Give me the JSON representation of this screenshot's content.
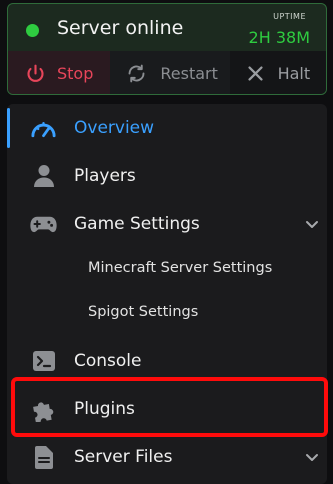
{
  "status": {
    "text": "Server online",
    "uptime_label": "UPTIME",
    "uptime_value": "2H 38M",
    "indicator_color": "#2ecc40"
  },
  "actions": {
    "stop_label": "Stop",
    "restart_label": "Restart",
    "halt_label": "Halt"
  },
  "nav": {
    "overview": "Overview",
    "players": "Players",
    "game_settings": "Game Settings",
    "minecraft_settings": "Minecraft Server Settings",
    "spigot_settings": "Spigot Settings",
    "console": "Console",
    "plugins": "Plugins",
    "server_files": "Server Files"
  },
  "colors": {
    "accent": "#3aa0ff",
    "stop": "#e8455a",
    "highlight": "#ff0b0b"
  },
  "icons": {
    "overview": "speedometer-icon",
    "players": "person-icon",
    "game_settings": "gamepad-icon",
    "console": "terminal-icon",
    "plugins": "puzzle-icon",
    "server_files": "file-icon"
  }
}
